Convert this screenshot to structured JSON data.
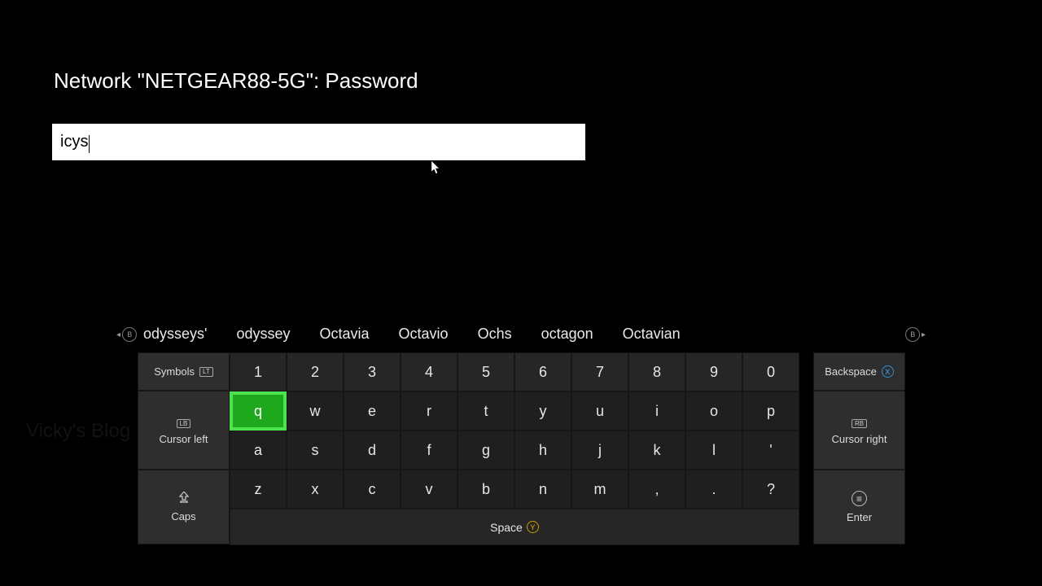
{
  "title": "Network \"NETGEAR88-5G\": Password",
  "input": {
    "value": "icys"
  },
  "watermark": "Vicky's Blog",
  "suggestions": [
    "odysseys'",
    "odyssey",
    "Octavia",
    "Octavio",
    "Ochs",
    "octagon",
    "Octavian"
  ],
  "side": {
    "symbols": "Symbols",
    "symbols_tag": "LT",
    "cursor_left": "Cursor left",
    "cursor_left_tag": "LB",
    "caps": "Caps",
    "backspace": "Backspace",
    "backspace_tag": "X",
    "cursor_right": "Cursor right",
    "cursor_right_tag": "RB",
    "enter": "Enter",
    "space": "Space",
    "space_tag": "Y"
  },
  "rows": {
    "num": [
      "1",
      "2",
      "3",
      "4",
      "5",
      "6",
      "7",
      "8",
      "9",
      "0"
    ],
    "r1": [
      "q",
      "w",
      "e",
      "r",
      "t",
      "y",
      "u",
      "i",
      "o",
      "p"
    ],
    "r2": [
      "a",
      "s",
      "d",
      "f",
      "g",
      "h",
      "j",
      "k",
      "l",
      "'"
    ],
    "r3": [
      "z",
      "x",
      "c",
      "v",
      "b",
      "n",
      "m",
      ",",
      ".",
      "?"
    ]
  },
  "selected_key": "q",
  "bumpers": {
    "left": "B",
    "right": "B"
  }
}
